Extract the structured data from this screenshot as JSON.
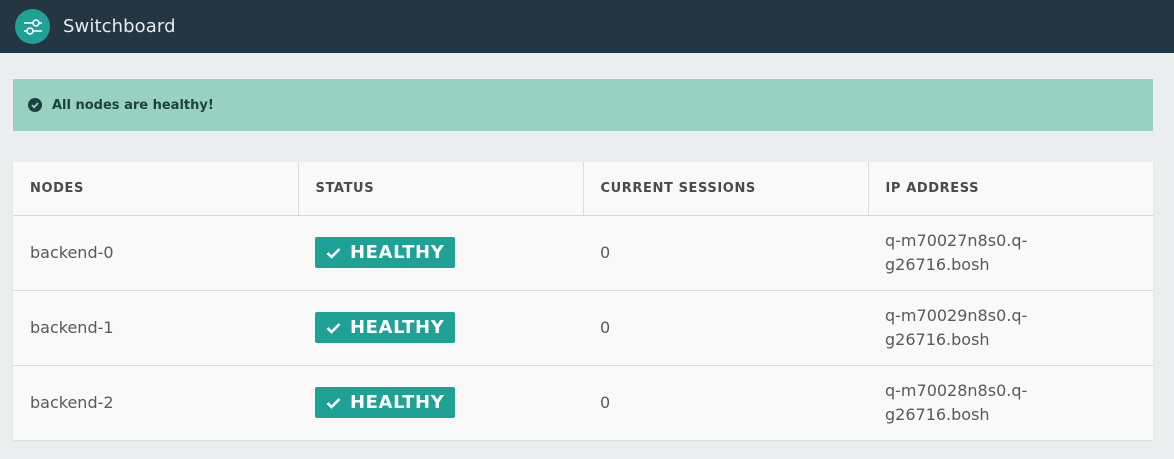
{
  "header": {
    "app_title": "Switchboard"
  },
  "alert": {
    "message": "All nodes are healthy!"
  },
  "table": {
    "columns": [
      "NODES",
      "STATUS",
      "CURRENT SESSIONS",
      "IP ADDRESS"
    ],
    "rows": [
      {
        "node": "backend-0",
        "status": "HEALTHY",
        "sessions": "0",
        "ip": "q-m70027n8s0.q-g26716.bosh"
      },
      {
        "node": "backend-1",
        "status": "HEALTHY",
        "sessions": "0",
        "ip": "q-m70029n8s0.q-g26716.bosh"
      },
      {
        "node": "backend-2",
        "status": "HEALTHY",
        "sessions": "0",
        "ip": "q-m70028n8s0.q-g26716.bosh"
      }
    ]
  },
  "colors": {
    "header_bg": "#243641",
    "accent": "#1fa196",
    "alert_bg": "#98d1c0",
    "page_bg": "#ebeeee"
  },
  "icons": {
    "logo": "switchboard-logo-icon",
    "alert": "check-circle-icon",
    "status": "check-icon"
  }
}
